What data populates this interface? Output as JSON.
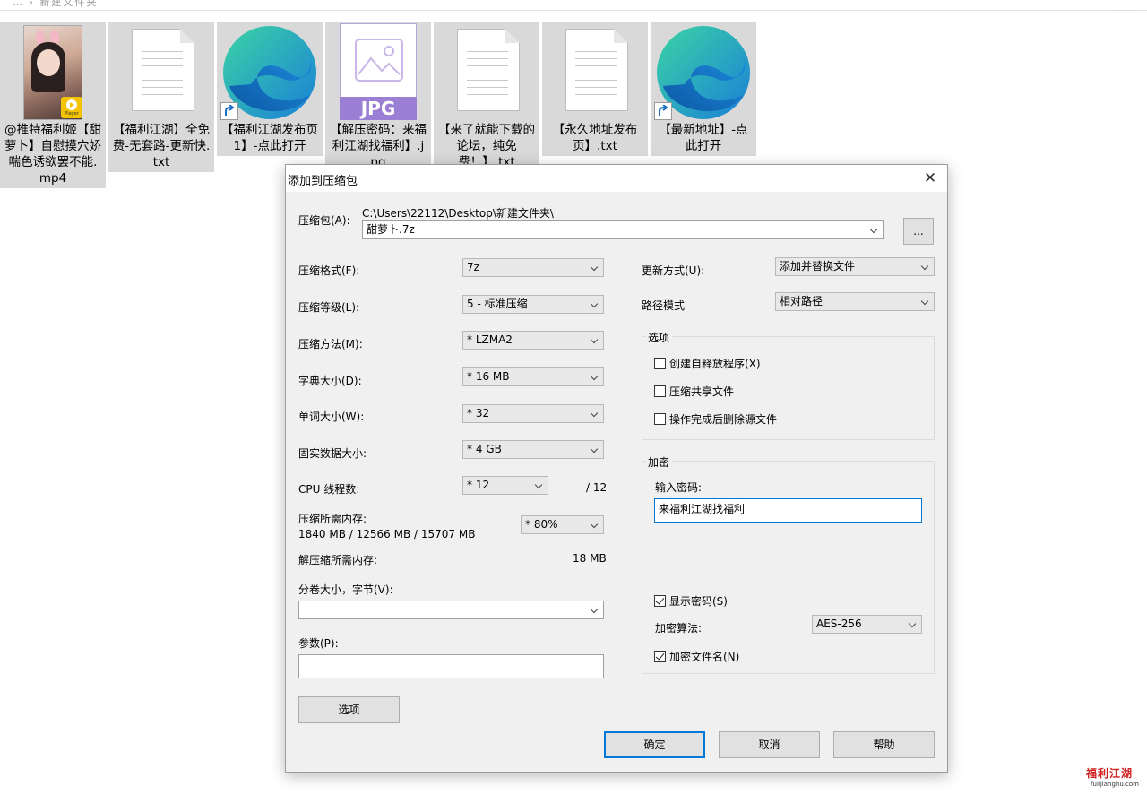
{
  "explorer": {
    "breadcrumb": "… › 新建文件夹",
    "files": [
      {
        "name": "@推特福利姬【甜萝卜】自慰摸穴娇喘色诱欲罢不能.mp4",
        "type": "video",
        "badge": "Player"
      },
      {
        "name": "【福利江湖】全免费-无套路-更新快.txt",
        "type": "txt"
      },
      {
        "name": "【福利江湖发布页1】-点此打开",
        "type": "edge-shortcut"
      },
      {
        "name": "【解压密码：来福利江湖找福利】.jpg",
        "type": "jpg",
        "badge": "JPG"
      },
      {
        "name": "【来了就能下载的论坛，纯免费！】.txt",
        "type": "txt"
      },
      {
        "name": "【永久地址发布页】.txt",
        "type": "txt"
      },
      {
        "name": "【最新地址】-点此打开",
        "type": "edge-shortcut"
      }
    ]
  },
  "dialog": {
    "title": "添加到压缩包",
    "archive_label": "压缩包(A):",
    "archive_path": "C:\\Users\\22112\\Desktop\\新建文件夹\\",
    "archive_name": "甜萝卜.7z",
    "browse_label": "...",
    "format_label": "压缩格式(F):",
    "format_value": "7z",
    "level_label": "压缩等级(L):",
    "level_value": "5 - 标准压缩",
    "method_label": "压缩方法(M):",
    "method_value": "*  LZMA2",
    "dict_label": "字典大小(D):",
    "dict_value": "*  16 MB",
    "word_label": "单词大小(W):",
    "word_value": "*  32",
    "solid_label": "固实数据大小:",
    "solid_value": "*  4 GB",
    "cpu_label": "CPU 线程数:",
    "cpu_value": "*  12",
    "cpu_total": "/ 12",
    "mem_label": "压缩所需内存:",
    "mem_value": "1840 MB / 12566 MB / 15707 MB",
    "mem_percent": "* 80%",
    "decomp_label": "解压缩所需内存:",
    "decomp_value": "18 MB",
    "split_label": "分卷大小，字节(V):",
    "split_value": "",
    "params_label": "参数(P):",
    "params_value": "",
    "options_button": "选项",
    "update_label": "更新方式(U):",
    "update_value": "添加并替换文件",
    "pathmode_label": "路径模式",
    "pathmode_value": "相对路径",
    "options_group": "选项",
    "opt_sfx": "创建自释放程序(X)",
    "opt_shared": "压缩共享文件",
    "opt_delete": "操作完成后删除源文件",
    "encrypt_group": "加密",
    "password_label": "输入密码:",
    "password_value": "来福利江湖找福利",
    "show_password": "显示密码(S)",
    "enc_method_label": "加密算法:",
    "enc_method_value": "AES-256",
    "encrypt_names": "加密文件名(N)",
    "ok_button": "确定",
    "cancel_button": "取消",
    "help_button": "帮助"
  },
  "watermark": {
    "title": "福利江湖",
    "url": "fulijianghu.com"
  }
}
